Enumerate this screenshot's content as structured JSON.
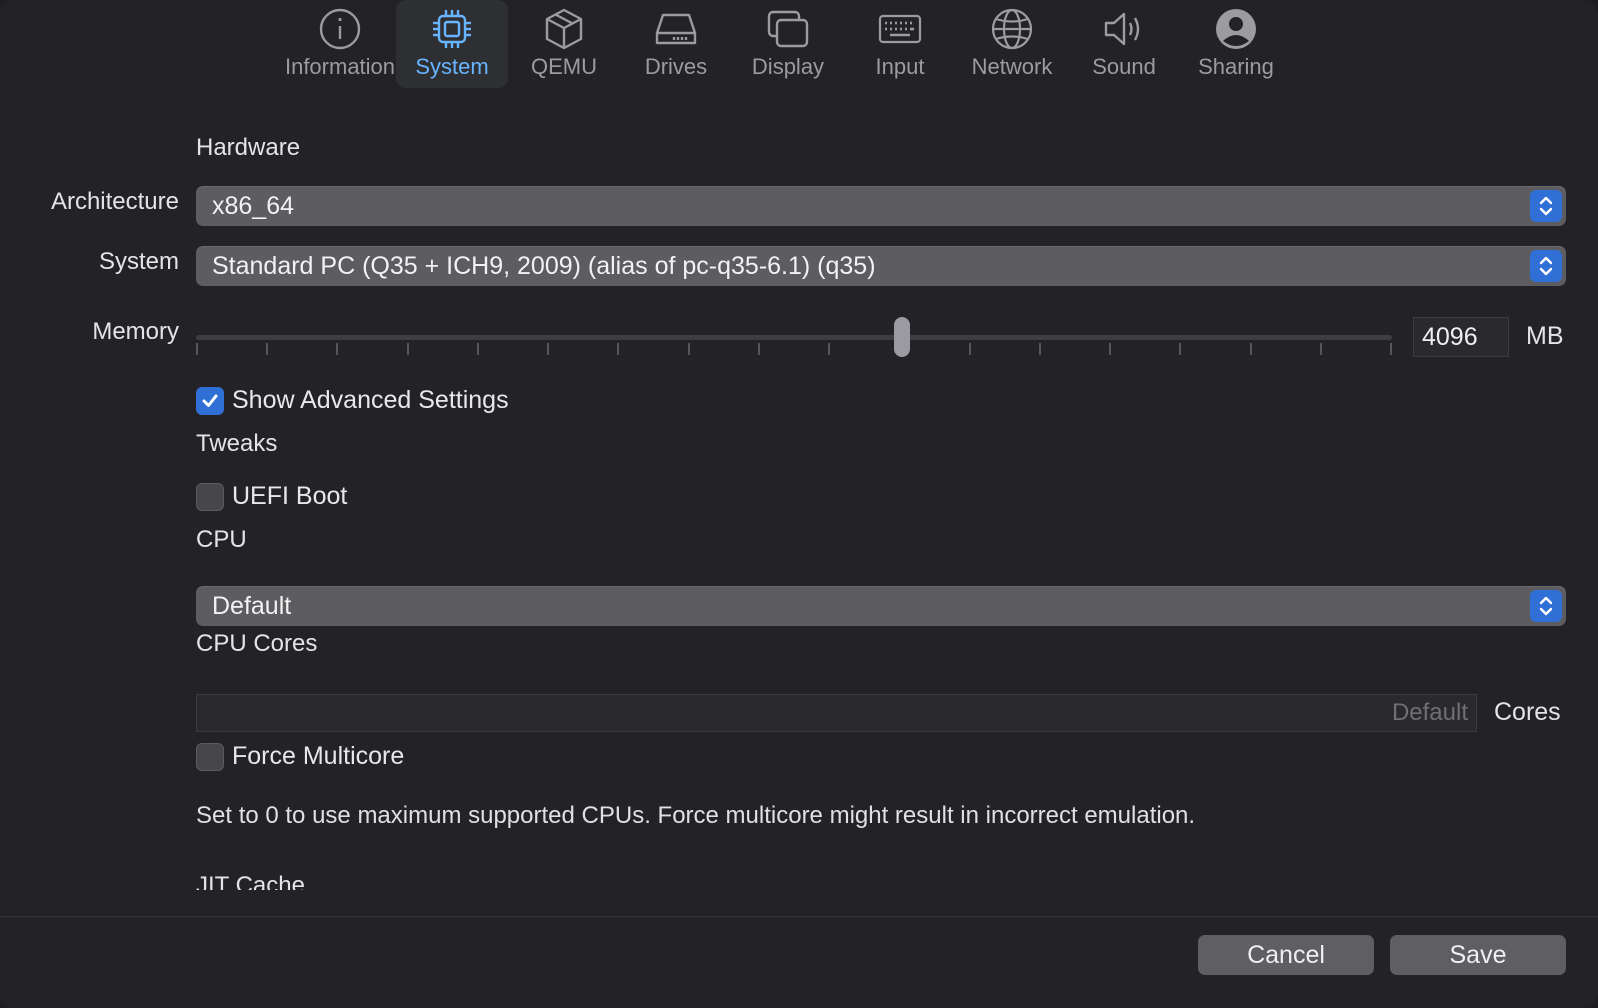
{
  "tabs": [
    {
      "label": "Information",
      "icon": "info-icon"
    },
    {
      "label": "System",
      "icon": "cpu-icon",
      "active": true
    },
    {
      "label": "QEMU",
      "icon": "cube-icon"
    },
    {
      "label": "Drives",
      "icon": "drive-icon"
    },
    {
      "label": "Display",
      "icon": "display-icon"
    },
    {
      "label": "Input",
      "icon": "keyboard-icon"
    },
    {
      "label": "Network",
      "icon": "globe-icon"
    },
    {
      "label": "Sound",
      "icon": "speaker-icon"
    },
    {
      "label": "Sharing",
      "icon": "person-icon"
    }
  ],
  "hardware": {
    "section_title": "Hardware",
    "architecture_label": "Architecture",
    "architecture_value": "x86_64",
    "system_label": "System",
    "system_value": "Standard PC (Q35 + ICH9, 2009) (alias of pc-q35-6.1) (q35)",
    "memory_label": "Memory",
    "memory_value": "4096",
    "memory_unit": "MB",
    "memory_level_fraction": 0.59
  },
  "advanced": {
    "show_advanced_label": "Show Advanced Settings",
    "show_advanced_checked": true,
    "tweaks_title": "Tweaks",
    "uefi_label": "UEFI Boot",
    "uefi_checked": false,
    "cpu_title": "CPU",
    "cpu_value": "Default",
    "cpu_cores_title": "CPU Cores",
    "cpu_cores_placeholder": "Default",
    "cpu_cores_unit": "Cores",
    "force_multicore_label": "Force Multicore",
    "force_multicore_checked": false,
    "help_text": "Set to 0 to use maximum supported CPUs. Force multicore might result in incorrect emulation.",
    "jit_title": "JIT Cache"
  },
  "footer": {
    "cancel_label": "Cancel",
    "save_label": "Save"
  },
  "colors": {
    "accent": "#2f6fd6",
    "active_tab_text": "#69b4ff",
    "background": "#232327"
  }
}
